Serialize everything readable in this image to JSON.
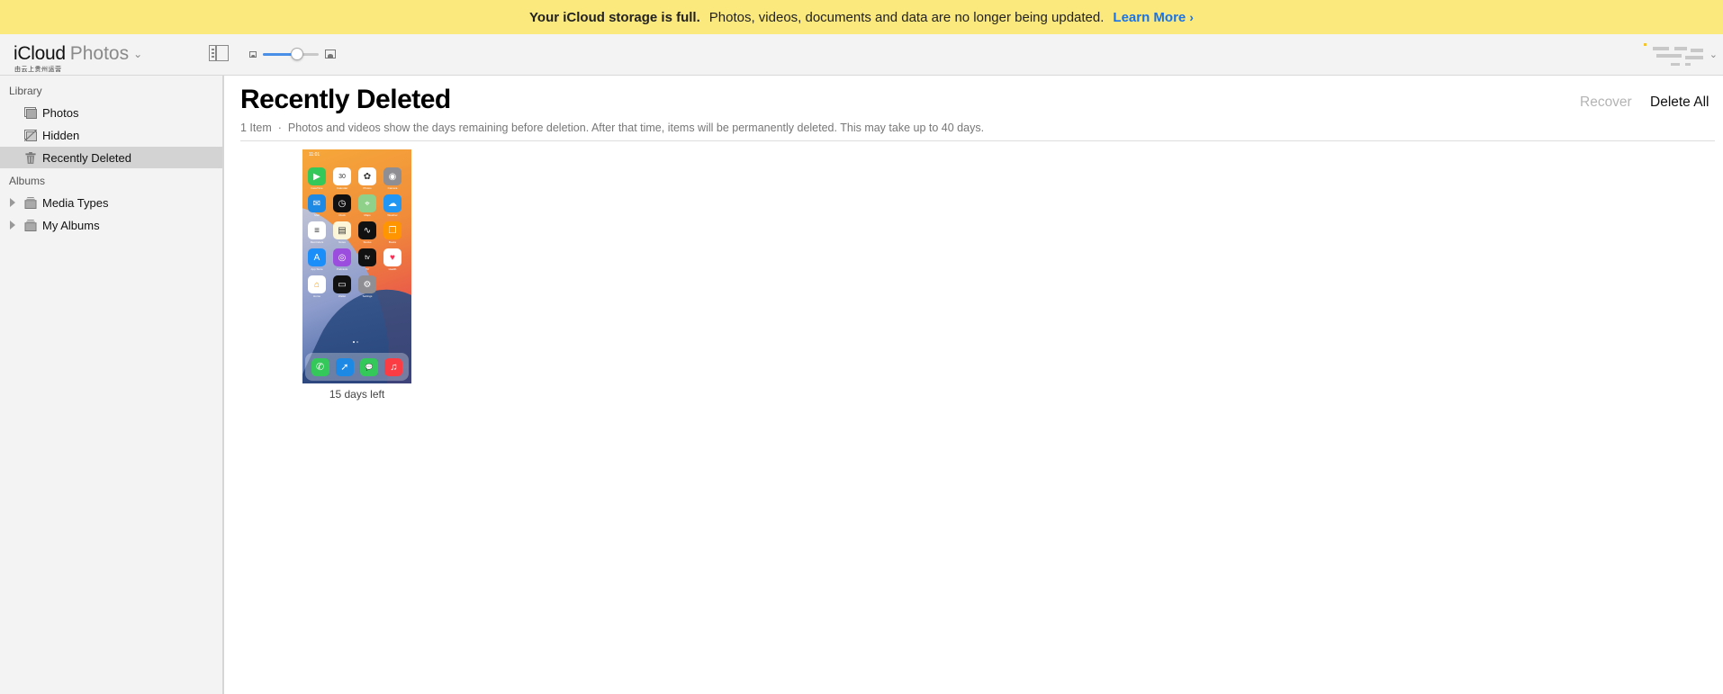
{
  "banner": {
    "strong_text": "Your iCloud storage is full.",
    "message": "Photos, videos, documents and data are no longer being updated.",
    "link_label": "Learn More",
    "link_chevron": "›",
    "background_color": "#fce97d",
    "link_color": "#1a73e8"
  },
  "toolbar": {
    "brand_primary": "iCloud",
    "brand_secondary": "Photos",
    "brand_dropdown_glyph": "⌄",
    "brand_subtitle": "由云上贵州运营",
    "zoom_slider_value": 0.62,
    "account_chevron": "⌄"
  },
  "sidebar": {
    "library_label": "Library",
    "library_items": [
      {
        "label": "Photos",
        "icon": "photos-icon",
        "active": false
      },
      {
        "label": "Hidden",
        "icon": "hidden-icon",
        "active": false
      },
      {
        "label": "Recently Deleted",
        "icon": "trash-icon",
        "active": true
      }
    ],
    "albums_label": "Albums",
    "album_items": [
      {
        "label": "Media Types",
        "icon": "album-stack-icon",
        "expandable": true
      },
      {
        "label": "My Albums",
        "icon": "album-stack-icon",
        "expandable": true
      }
    ]
  },
  "main": {
    "title": "Recently Deleted",
    "item_count": "1 Item",
    "separator": "·",
    "description": "Photos and videos show the days remaining before deletion. After that time, items will be permanently deleted. This may take up to 40 days.",
    "actions": {
      "recover_label": "Recover",
      "recover_enabled": false,
      "delete_all_label": "Delete All"
    },
    "items": [
      {
        "type": "screenshot",
        "days_left_label": "15 days left",
        "preview": {
          "status_time": "11:01",
          "apps": [
            {
              "name": "FaceTime",
              "glyph": "▶",
              "color": "#34c759"
            },
            {
              "name": "Calendar",
              "glyph": "30",
              "color": "#ffffff"
            },
            {
              "name": "Photos",
              "glyph": "✿",
              "color": "#ffffff"
            },
            {
              "name": "Camera",
              "glyph": "◉",
              "color": "#8e8e93"
            },
            {
              "name": "Mail",
              "glyph": "✉",
              "color": "#1e88e5"
            },
            {
              "name": "Clock",
              "glyph": "◷",
              "color": "#111111"
            },
            {
              "name": "Maps",
              "glyph": "⌖",
              "color": "#8fd18a"
            },
            {
              "name": "Weather",
              "glyph": "☁",
              "color": "#2196f3"
            },
            {
              "name": "Reminders",
              "glyph": "≡",
              "color": "#ffffff"
            },
            {
              "name": "Notes",
              "glyph": "▤",
              "color": "#fdf6d8"
            },
            {
              "name": "Stocks",
              "glyph": "∿",
              "color": "#111111"
            },
            {
              "name": "Books",
              "glyph": "❐",
              "color": "#ff9500"
            },
            {
              "name": "App Store",
              "glyph": "A",
              "color": "#1c8ef9"
            },
            {
              "name": "Podcasts",
              "glyph": "◎",
              "color": "#9b4dde"
            },
            {
              "name": "TV",
              "glyph": "tv",
              "color": "#111111"
            },
            {
              "name": "Health",
              "glyph": "♥",
              "color": "#ffffff"
            },
            {
              "name": "Home",
              "glyph": "⌂",
              "color": "#ffffff"
            },
            {
              "name": "Wallet",
              "glyph": "▭",
              "color": "#111111"
            },
            {
              "name": "Settings",
              "glyph": "⚙",
              "color": "#8e8e93"
            }
          ],
          "dock": [
            {
              "name": "Phone",
              "glyph": "✆",
              "color": "#34c759"
            },
            {
              "name": "Safari",
              "glyph": "➚",
              "color": "#1e88e5"
            },
            {
              "name": "Messages",
              "glyph": "💬",
              "color": "#34c759"
            },
            {
              "name": "Music",
              "glyph": "♫",
              "color": "#fc3c44"
            }
          ]
        }
      }
    ]
  }
}
